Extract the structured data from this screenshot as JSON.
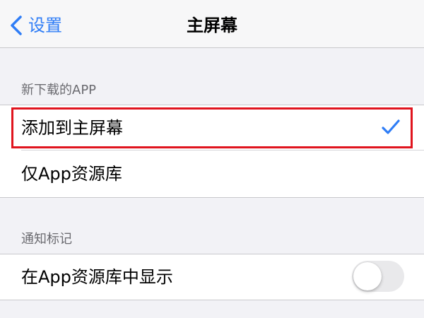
{
  "navbar": {
    "back_label": "设置",
    "title": "主屏幕",
    "back_icon": "chevron-left-icon"
  },
  "sections": [
    {
      "header": "新下载的APP",
      "rows": [
        {
          "label": "添加到主屏幕",
          "selected": true
        },
        {
          "label": "仅App资源库",
          "selected": false
        }
      ]
    },
    {
      "header": "通知标记",
      "rows": [
        {
          "label": "在App资源库中显示",
          "toggle_on": false
        }
      ]
    }
  ],
  "colors": {
    "accent": "#2f7df6",
    "highlight": "#e0141e",
    "background": "#f2f2f6"
  }
}
